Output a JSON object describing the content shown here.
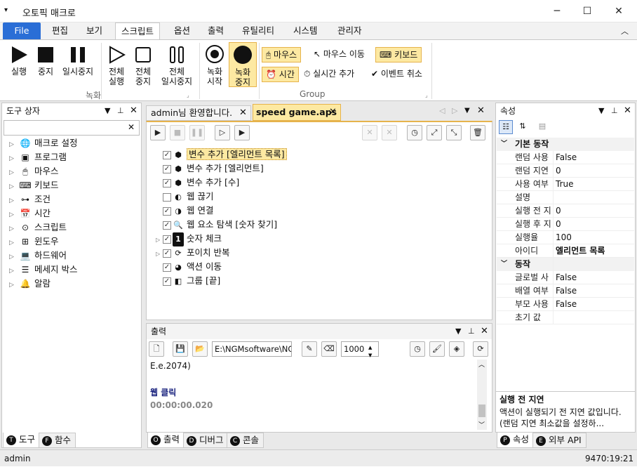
{
  "window": {
    "title": "오토픽 매크로",
    "minimize": "─",
    "maximize": "☐",
    "close": "✕"
  },
  "menu": {
    "file": "File",
    "items": [
      "편집",
      "보기",
      "스크립트",
      "옵션",
      "출력",
      "유틸리티",
      "시스템",
      "관리자"
    ]
  },
  "ribbon": {
    "run": "실행",
    "stop": "중지",
    "pause": "일시중지",
    "run_all": [
      "전체",
      "실행"
    ],
    "stop_all": [
      "전체",
      "중지"
    ],
    "pause_all": [
      "전체",
      "일시중지"
    ],
    "rec_start": [
      "녹화",
      "시작"
    ],
    "rec_stop": [
      "녹화",
      "중지"
    ],
    "group_rec": "녹화",
    "group_group": "Group",
    "mouse": "마우스",
    "mouse_move": "마우스 이동",
    "keyboard": "키보드",
    "time": "시간",
    "realtime_add": "실시간 추가",
    "event_cancel": "이벤트 취소"
  },
  "toolbox": {
    "title": "도구 상자",
    "items": [
      "매크로 설정",
      "프로그램",
      "마우스",
      "키보드",
      "조건",
      "시간",
      "스크립트",
      "윈도우",
      "하드웨어",
      "메세지 박스",
      "알람"
    ],
    "tabs": [
      "도구",
      "함수"
    ]
  },
  "editor": {
    "tabs": [
      "admin님 환영합니다.",
      "speed game.aps"
    ],
    "actions": [
      {
        "label": "변수 추가 [엘리먼트 목록]",
        "checked": true,
        "icon": "cube-icon",
        "selected": true
      },
      {
        "label": "변수 추가 [엘리먼트]",
        "checked": true,
        "icon": "cube-icon"
      },
      {
        "label": "변수 추가 [수]",
        "checked": true,
        "icon": "cube-icon"
      },
      {
        "label": "웹 끊기",
        "checked": false,
        "icon": "web-disconnect-icon"
      },
      {
        "label": "웹 연결",
        "checked": true,
        "icon": "web-connect-icon"
      },
      {
        "label": "웹 요소 탐색 [숫자 찾기]",
        "checked": true,
        "icon": "magnifier-icon"
      },
      {
        "label": "숫자 체크",
        "checked": true,
        "icon": "number-one-icon",
        "expandable": true
      },
      {
        "label": "포이치 반복",
        "checked": true,
        "icon": "loop-icon",
        "expandable": true
      },
      {
        "label": "액션 이동",
        "checked": true,
        "icon": "action-move-icon"
      },
      {
        "label": "그룹 [끝]",
        "checked": true,
        "icon": "group-end-icon"
      }
    ]
  },
  "output": {
    "title": "출력",
    "path": "E:\\NGMsoftware\\NG",
    "count": "1000",
    "lines": [
      "E.e.2074)",
      "",
      "웹 클릭",
      "00:00:00.020"
    ],
    "tabs": [
      "출력",
      "디버그",
      "콘솔"
    ]
  },
  "properties": {
    "title": "속성",
    "cat1": "기본 동작",
    "rows1": [
      {
        "k": "랜덤 사용",
        "v": "False"
      },
      {
        "k": "랜덤 지연",
        "v": "0"
      },
      {
        "k": "사용 여부",
        "v": "True"
      },
      {
        "k": "설명",
        "v": ""
      },
      {
        "k": "실행 전 지",
        "v": "0"
      },
      {
        "k": "실행 후 지",
        "v": "0"
      },
      {
        "k": "실행율",
        "v": "100"
      },
      {
        "k": "아이디",
        "v": "엘리먼트 목록"
      }
    ],
    "cat2": "동작",
    "rows2": [
      {
        "k": "글로벌 사",
        "v": "False"
      },
      {
        "k": "배열 여부",
        "v": "False"
      },
      {
        "k": "부모 사용",
        "v": "False"
      },
      {
        "k": "초기 값",
        "v": ""
      }
    ],
    "desc_title": "실행 전 지연",
    "desc_text": "액션이 실행되기 전 지연 값입니다. (랜덤 지연 최소값을 설정하...",
    "tabs": [
      "속성",
      "외부 API"
    ]
  },
  "status": {
    "user": "admin",
    "right": "9470:19:21"
  }
}
